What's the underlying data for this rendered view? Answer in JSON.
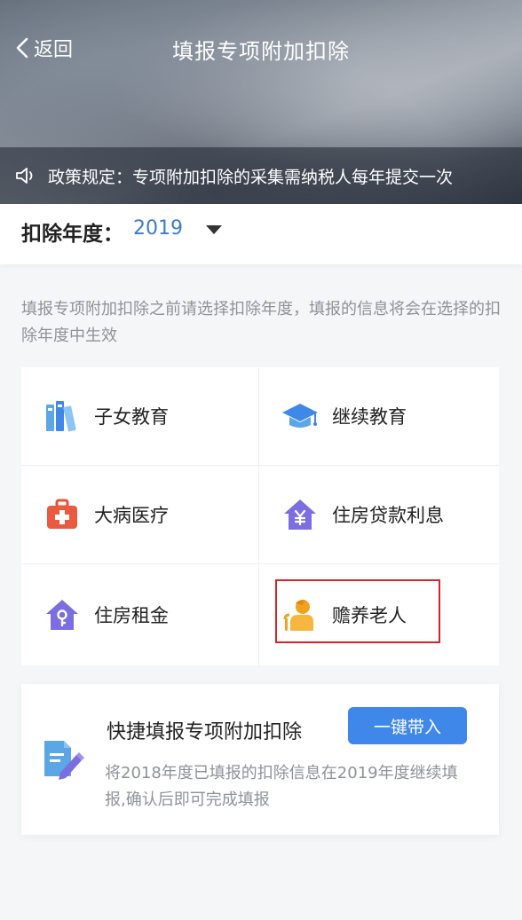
{
  "header": {
    "back_label": "返回",
    "title": "填报专项附加扣除"
  },
  "notice": {
    "text": "政策规定：专项附加扣除的采集需纳税人每年提交一次"
  },
  "year_selector": {
    "label": "扣除年度：",
    "value": "2019"
  },
  "tip": "填报专项附加扣除之前请选择扣除年度，填报的信息将会在选择的扣除年度中生效",
  "categories": [
    {
      "label": "子女教育",
      "icon": "books-icon"
    },
    {
      "label": "继续教育",
      "icon": "graduation-cap-icon"
    },
    {
      "label": "大病医疗",
      "icon": "medical-kit-icon"
    },
    {
      "label": "住房贷款利息",
      "icon": "house-yen-icon"
    },
    {
      "label": "住房租金",
      "icon": "house-key-icon"
    },
    {
      "label": "赡养老人",
      "icon": "elderly-person-icon"
    }
  ],
  "quick_fill": {
    "title": "快捷填报专项附加扣除",
    "button_label": "一键带入",
    "description": "将2018年度已填报的扣除信息在2019年度继续填报,确认后即可完成填报"
  },
  "colors": {
    "accent": "#3f87e8",
    "year_value": "#3d7cc9",
    "highlight": "#d9232a"
  }
}
